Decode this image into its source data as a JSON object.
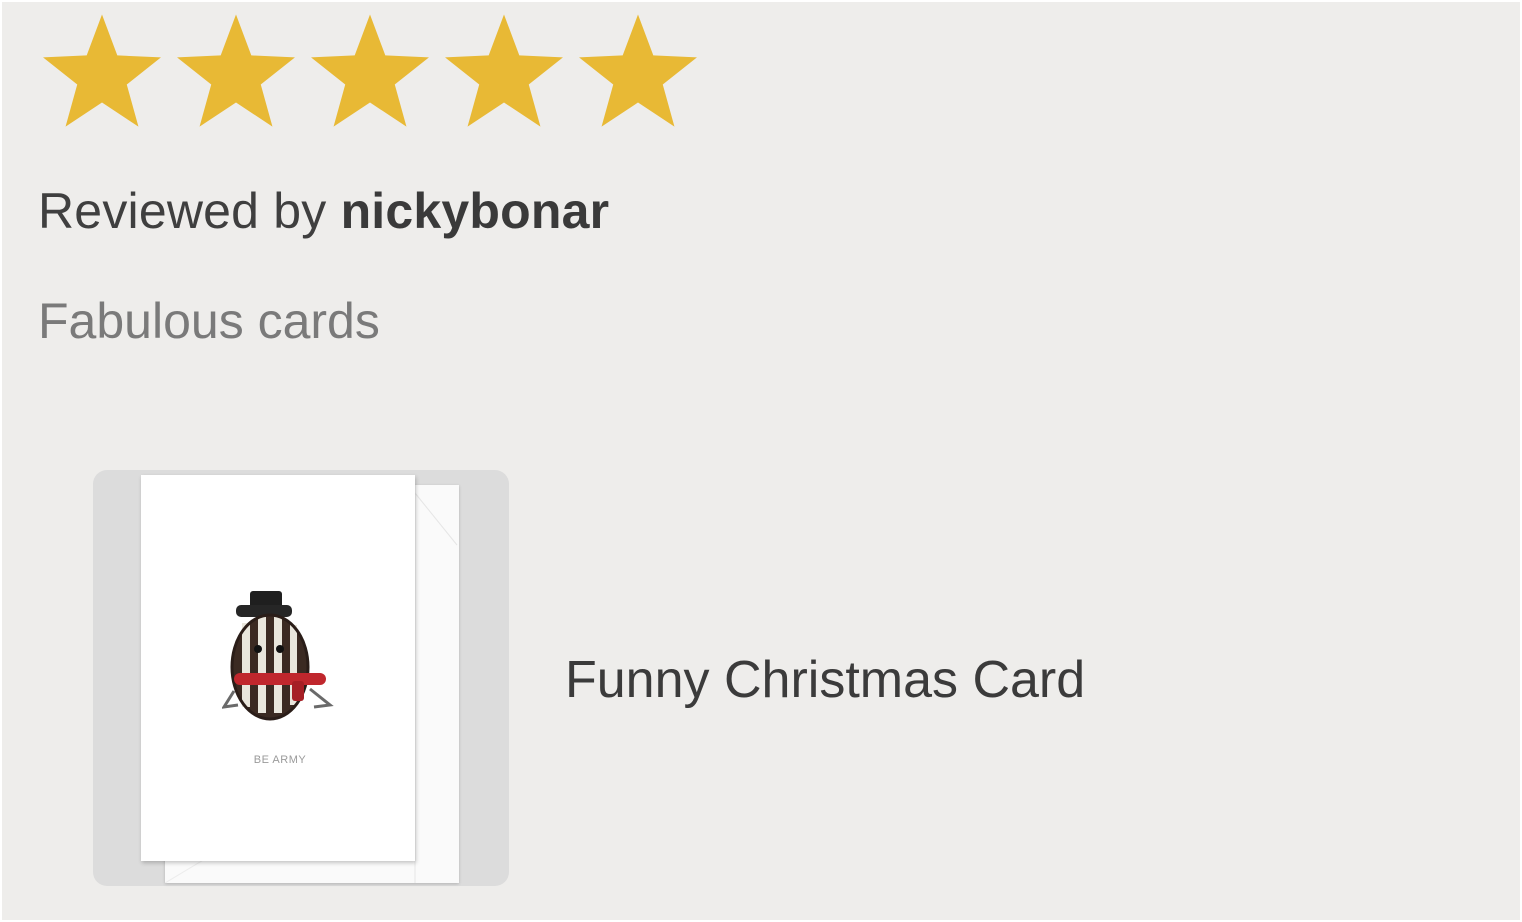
{
  "rating": {
    "value": 5,
    "max": 5,
    "star_color": "#e8b935",
    "icon": "star-icon"
  },
  "review": {
    "prefix": "Reviewed by",
    "reviewer": "nickybonar",
    "title": "Fabulous cards"
  },
  "product": {
    "name": "Funny Christmas Card",
    "card_caption": "BE ARMY"
  },
  "colors": {
    "background": "#eeedeb",
    "thumb_background": "#dcdcdc",
    "text": "#3f3f3f",
    "muted_text": "#7a7a7a",
    "scarf": "#c0272d"
  }
}
